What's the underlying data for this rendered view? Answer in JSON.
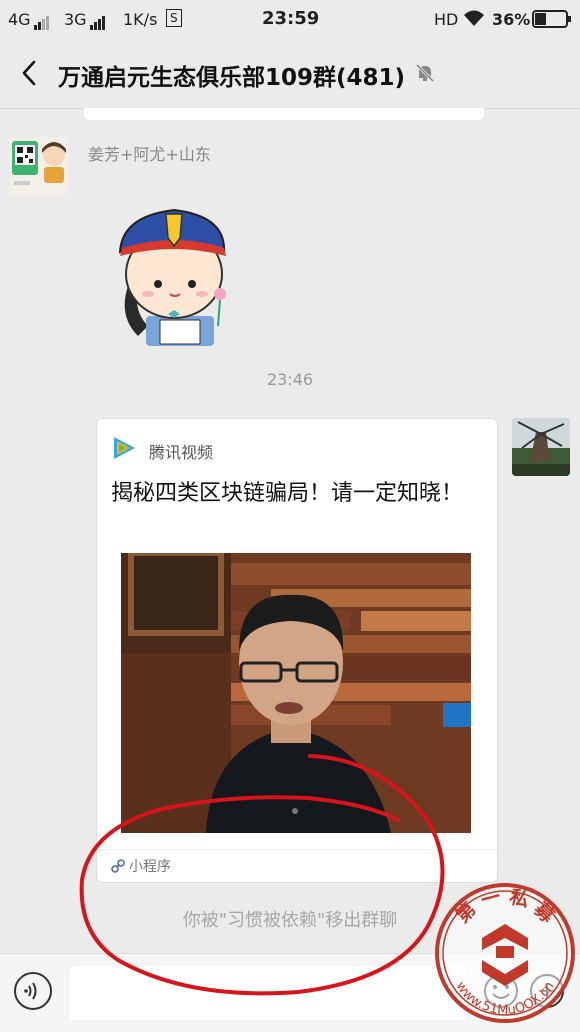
{
  "status_bar": {
    "network1": "4G",
    "network2": "3G",
    "speed": "1K/s",
    "sim_badge": "S",
    "time": "23:59",
    "hd": "HD",
    "battery": "36%"
  },
  "header": {
    "title": "万通启元生态俱乐部109群(481)"
  },
  "messages": {
    "sender_name": "姜芳+阿尤+山东",
    "timestamp": "23:46",
    "card": {
      "source": "腾讯视频",
      "headline": "揭秘四类区块链骗局！请一定知晓！",
      "footer_label": "小程序"
    },
    "system_notice": "你被\"习惯被依赖\"移出群聊"
  },
  "watermark": {
    "top_text": "第 一 私 募",
    "bottom_text": "www.51MuOOX.cn"
  },
  "colors": {
    "background": "#ebebeb",
    "annotation_red": "#d8141a",
    "watermark_red": "#c0392b"
  }
}
